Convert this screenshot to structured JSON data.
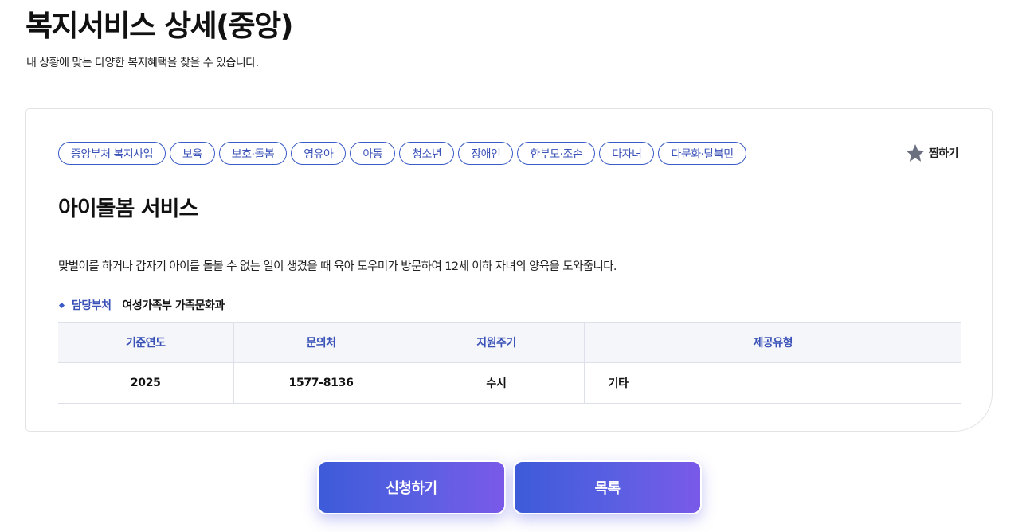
{
  "page": {
    "title": "복지서비스 상세(중앙)",
    "subtitle": "내 상황에 맞는 다양한 복지혜택을 찾을 수 있습니다."
  },
  "service": {
    "tags": [
      "중앙부처 복지사업",
      "보육",
      "보호·돌봄",
      "영유아",
      "아동",
      "청소년",
      "장애인",
      "한부모·조손",
      "다자녀",
      "다문화·탈북민"
    ],
    "favorite_label": "찜하기",
    "favorite_icon": "star-icon",
    "title": "아이돌봄 서비스",
    "description": "맞벌이를 하거나 갑자기 아이를 돌볼 수 없는 일이 생겼을 때 육아 도우미가 방문하여 12세 이하 자녀의 양육을 도와줍니다.",
    "department_label": "담당부처",
    "department_value": "여성가족부 가족문화과"
  },
  "info_table": {
    "headers": [
      "기준연도",
      "문의처",
      "지원주기",
      "제공유형"
    ],
    "row": [
      "2025",
      "1577-8136",
      "수시",
      "기타"
    ]
  },
  "actions": {
    "apply_label": "신청하기",
    "list_label": "목록"
  },
  "colors": {
    "accent": "#3a52b8",
    "button_gradient_start": "#3d5bd9",
    "button_gradient_end": "#7a5ae8"
  }
}
